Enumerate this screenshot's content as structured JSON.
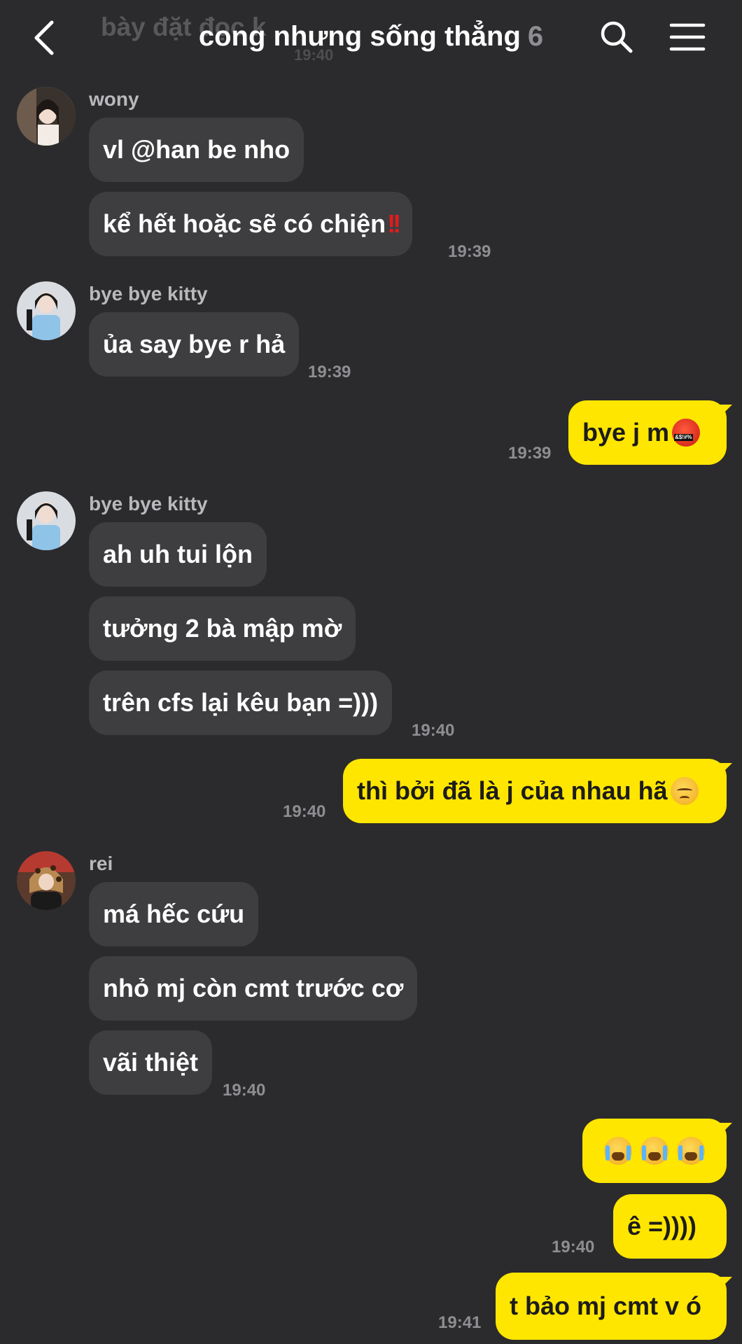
{
  "header": {
    "ghost_prev_text": "bày đặt đọc k",
    "ghost_prev_time": "19:40",
    "title": "cong nhưng sống thẳng",
    "member_count": "6"
  },
  "messages": {
    "g1": {
      "sender": "wony",
      "m1": "vl @han be nho",
      "m2": "kể hết hoặc sẽ có chiện",
      "m2_suffix": "!!",
      "time": "19:39"
    },
    "g2": {
      "sender": "bye bye kitty",
      "m1": "ủa say bye r hả",
      "time": "19:39"
    },
    "o1": {
      "m1": "bye j m",
      "time": "19:39"
    },
    "g3": {
      "sender": "bye bye kitty",
      "m1": "ah uh tui lộn",
      "m2": "tưởng 2 bà mập mờ",
      "m3": "trên cfs lại kêu bạn =)))",
      "time": "19:40"
    },
    "o2": {
      "m1": "thì bởi đã là j của nhau hã",
      "time": "19:40"
    },
    "g4": {
      "sender": "rei",
      "m1": "má hếc cứu",
      "m2": "nhỏ mj còn cmt trước cơ",
      "m3": "vãi thiệt",
      "time": "19:40"
    },
    "o3": {
      "m1_emoji": "loudly-crying-face x3",
      "m2": "ê =))))",
      "time": "19:40"
    },
    "o4": {
      "m1": "t bảo mj cmt v ó",
      "time": "19:41"
    }
  },
  "colors": {
    "background": "#2b2b2d",
    "incoming_bubble": "#3e3e41",
    "outgoing_bubble": "#ffe600",
    "timestamp": "#8e8e92"
  },
  "icons": {
    "back": "chevron-left-icon",
    "search": "search-icon",
    "menu": "hamburger-menu-icon"
  }
}
